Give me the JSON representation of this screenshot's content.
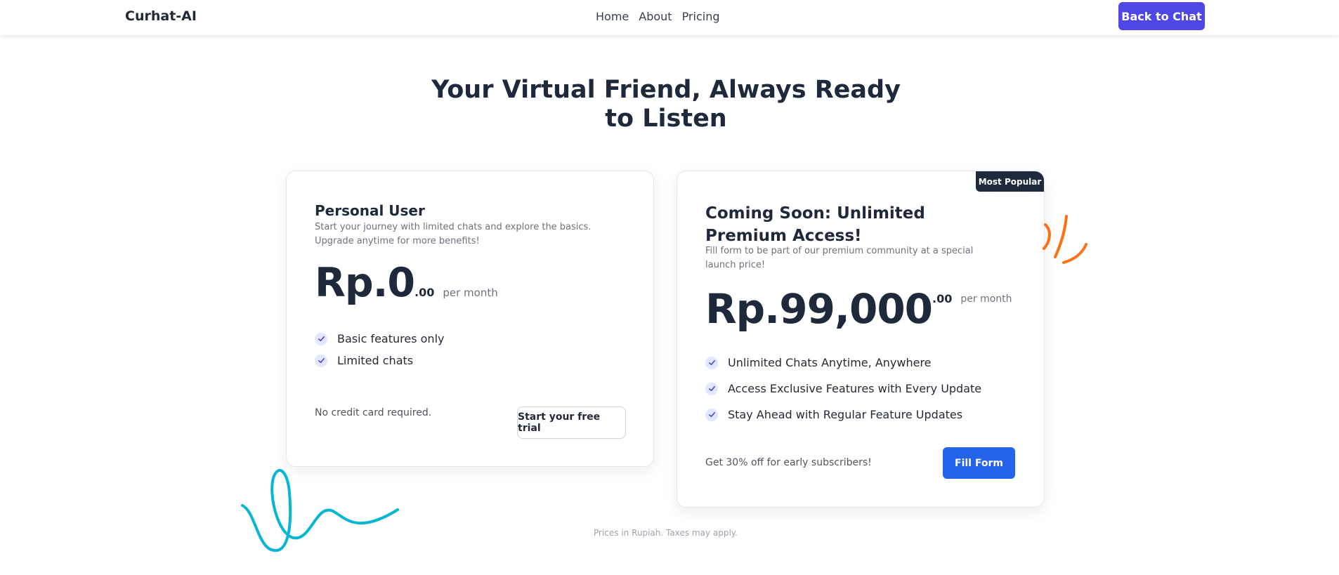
{
  "nav": {
    "brand": "Curhat-AI",
    "links": [
      "Home",
      "About",
      "Pricing"
    ],
    "cta_label": "Back to Chat"
  },
  "hero": {
    "title": "Your Virtual Friend, Always Ready to Listen"
  },
  "plans": [
    {
      "title": "Personal User",
      "description": "Start your journey with limited chats and explore the basics. Upgrade anytime for more benefits!",
      "price": "Rp.0",
      "cents": ".00",
      "period": "per month",
      "features": [
        "Basic features only",
        "Limited chats"
      ],
      "footnote": "No credit card required.",
      "button_label": "Start your free trial"
    },
    {
      "badge": "Most Popular",
      "title": "Coming Soon: Unlimited Premium Access!",
      "description": "Fill form to be part of our premium community at a special launch price!",
      "price": "Rp.99,000",
      "cents": ".00",
      "period": "per month",
      "features": [
        "Unlimited Chats Anytime, Anywhere",
        "Access Exclusive Features with Every Update",
        "Stay Ahead with Regular Feature Updates"
      ],
      "footnote": "Get 30% off for early subscribers!",
      "button_label": "Fill Form"
    }
  ],
  "footer_note": "Prices in Rupiah. Taxes may apply.",
  "colors": {
    "primary_indigo": "#4f46e5",
    "primary_blue": "#2563eb",
    "dark_text": "#1e293b",
    "check_bg": "#e0e7ff",
    "squiggle_orange": "#f97316",
    "squiggle_cyan": "#06b6d4"
  },
  "icons": {
    "feature_check": "check-icon"
  }
}
